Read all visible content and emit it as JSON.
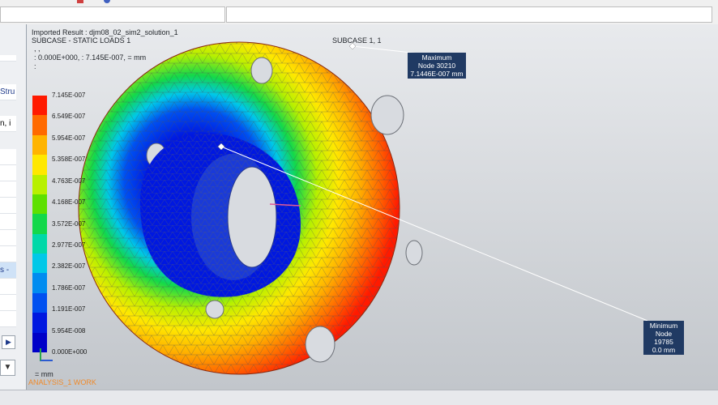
{
  "header": {
    "result_title": "Imported Result : djm08_02_sim2_solution_1",
    "subcase_title": "SUBCASE - STATIC LOADS 1",
    "line3": ", ,",
    "range_text": ": 0.000E+000, : 7.145E-007, = mm",
    "line5": ":"
  },
  "subcase_label": "SUBCASE 1, 1",
  "legend": {
    "labels": [
      "7.145E-007",
      "6.549E-007",
      "5.954E-007",
      "5.358E-007",
      "4.763E-007",
      "4.168E-007",
      "3.572E-007",
      "2.977E-007",
      "2.382E-007",
      "1.786E-007",
      "1.191E-007",
      "5.954E-008",
      "0.000E+000"
    ],
    "colors": [
      "#ff1a00",
      "#ff6a00",
      "#ffb400",
      "#ffe800",
      "#b8f000",
      "#5ee000",
      "#13d84a",
      "#00d8a8",
      "#00c8e8",
      "#008cf0",
      "#0050f0",
      "#0018e0",
      "#0000c8"
    ],
    "unit": "= mm"
  },
  "callouts": {
    "max": {
      "title": "Maximum",
      "node": "Node 30210",
      "value": "7.1446E-007 mm"
    },
    "min": {
      "title": "Minimum",
      "node": "Node 19785",
      "value": "0.0 mm"
    }
  },
  "status": {
    "label": "ANALYSIS_1 WORK"
  },
  "left_panel": {
    "row1": "Stru",
    "row2": "n, i",
    "row3": "s -"
  }
}
